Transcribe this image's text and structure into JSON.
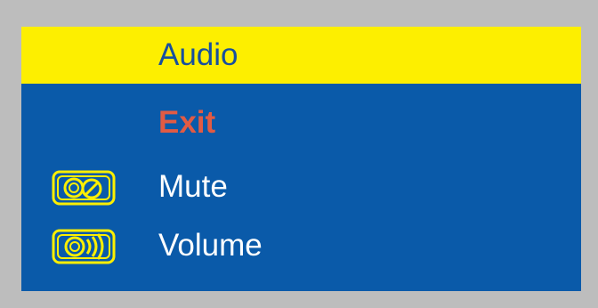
{
  "osd": {
    "title": "Audio",
    "items": [
      {
        "label": "Exit",
        "icon": ""
      },
      {
        "label": "Mute",
        "icon": "mute-speaker-icon"
      },
      {
        "label": "Volume",
        "icon": "volume-speaker-icon"
      }
    ]
  },
  "colors": {
    "background": "#bdbdbd",
    "panel": "#0a5aa9",
    "header": "#fdef00",
    "title_text": "#174f9e",
    "exit_text": "#e15b44",
    "item_text": "#ffffff",
    "icon_stroke": "#fdef00"
  }
}
